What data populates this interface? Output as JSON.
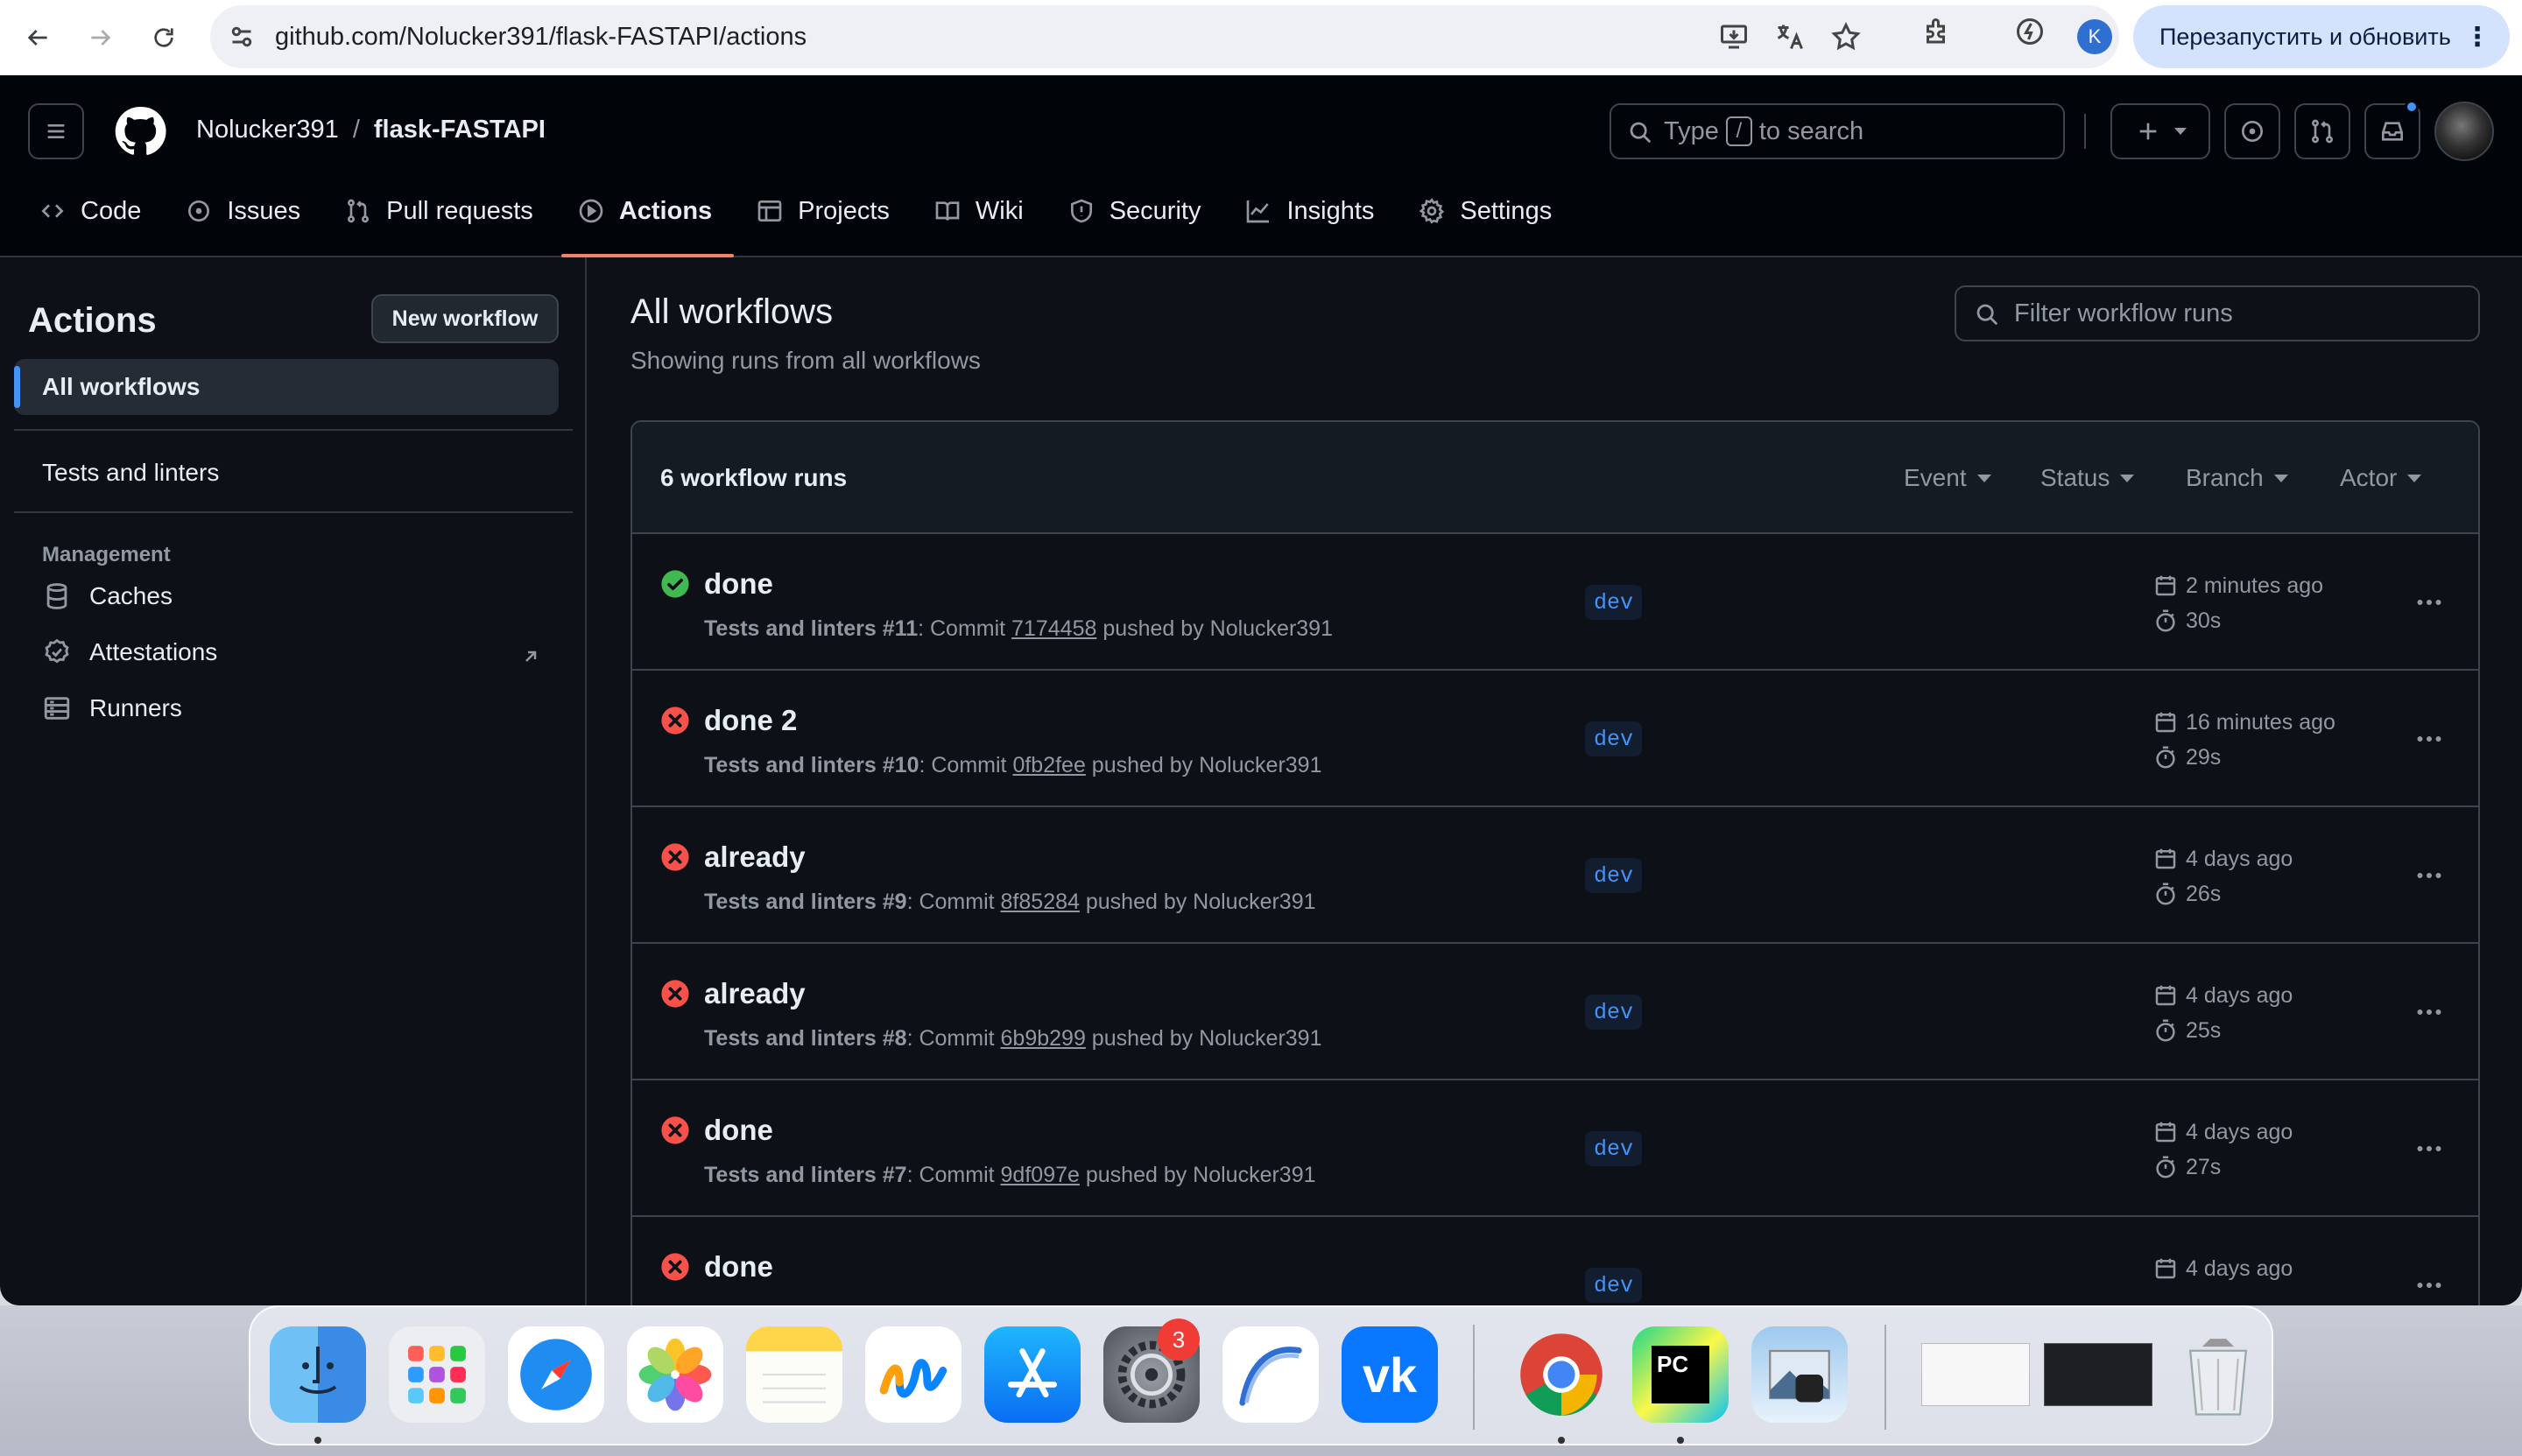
{
  "browser": {
    "url": "github.com/Nolucker391/flask-FASTAPI/actions",
    "profile_initial": "K",
    "relaunch_label": "Перезапустить и обновить"
  },
  "header": {
    "owner": "Nolucker391",
    "separator": "/",
    "repo": "flask-FASTAPI",
    "search_prefix": "Type",
    "search_key": "/",
    "search_suffix": "to search"
  },
  "tabs": [
    {
      "label": "Code",
      "icon": "code-icon"
    },
    {
      "label": "Issues",
      "icon": "issue-icon"
    },
    {
      "label": "Pull requests",
      "icon": "pull-request-icon"
    },
    {
      "label": "Actions",
      "icon": "play-icon",
      "active": true
    },
    {
      "label": "Projects",
      "icon": "table-icon"
    },
    {
      "label": "Wiki",
      "icon": "book-icon"
    },
    {
      "label": "Security",
      "icon": "shield-icon"
    },
    {
      "label": "Insights",
      "icon": "graph-icon"
    },
    {
      "label": "Settings",
      "icon": "gear-icon"
    }
  ],
  "sidebar": {
    "title": "Actions",
    "new_workflow": "New workflow",
    "all_workflows": "All workflows",
    "workflows": [
      "Tests and linters"
    ],
    "management_heading": "Management",
    "management": [
      {
        "label": "Caches",
        "icon": "database-icon"
      },
      {
        "label": "Attestations",
        "icon": "verified-icon"
      },
      {
        "label": "Runners",
        "icon": "server-icon"
      }
    ]
  },
  "main": {
    "title": "All workflows",
    "subtitle": "Showing runs from all workflows",
    "filter_placeholder": "Filter workflow runs",
    "runs_count": "6 workflow runs",
    "filters": [
      "Event",
      "Status",
      "Branch",
      "Actor"
    ],
    "runs": [
      {
        "status": "success",
        "title": "done",
        "workflow": "Tests and linters #11",
        "commit_prefix": ": Commit ",
        "sha": "7174458",
        "pushed_by": " pushed by Nolucker391",
        "branch": "dev",
        "when": "2 minutes ago",
        "duration": "30s"
      },
      {
        "status": "failure",
        "title": "done 2",
        "workflow": "Tests and linters #10",
        "commit_prefix": ": Commit ",
        "sha": "0fb2fee",
        "pushed_by": " pushed by Nolucker391",
        "branch": "dev",
        "when": "16 minutes ago",
        "duration": "29s"
      },
      {
        "status": "failure",
        "title": "already",
        "workflow": "Tests and linters #9",
        "commit_prefix": ": Commit ",
        "sha": "8f85284",
        "pushed_by": " pushed by Nolucker391",
        "branch": "dev",
        "when": "4 days ago",
        "duration": "26s"
      },
      {
        "status": "failure",
        "title": "already",
        "workflow": "Tests and linters #8",
        "commit_prefix": ": Commit ",
        "sha": "6b9b299",
        "pushed_by": " pushed by Nolucker391",
        "branch": "dev",
        "when": "4 days ago",
        "duration": "25s"
      },
      {
        "status": "failure",
        "title": "done",
        "workflow": "Tests and linters #7",
        "commit_prefix": ": Commit ",
        "sha": "9df097e",
        "pushed_by": " pushed by Nolucker391",
        "branch": "dev",
        "when": "4 days ago",
        "duration": "27s"
      },
      {
        "status": "failure",
        "title": "done",
        "workflow": "",
        "commit_prefix": "",
        "sha": "",
        "pushed_by": "",
        "branch": "dev",
        "when": "4 days ago",
        "duration": ""
      }
    ]
  },
  "dock": {
    "apps": [
      "Finder",
      "Launchpad",
      "Safari",
      "Photos",
      "Notes",
      "Freeform",
      "App Store",
      "System Settings",
      "Arc",
      "VK",
      "Chrome",
      "PyCharm",
      "Preview",
      "Window 1",
      "Window 2",
      "Trash"
    ],
    "settings_badge": "3"
  },
  "colors": {
    "accent_underline": "#f78166",
    "success": "#3fb950",
    "failure": "#f85149",
    "link_blue": "#4493f8",
    "bg": "#0d1117"
  }
}
